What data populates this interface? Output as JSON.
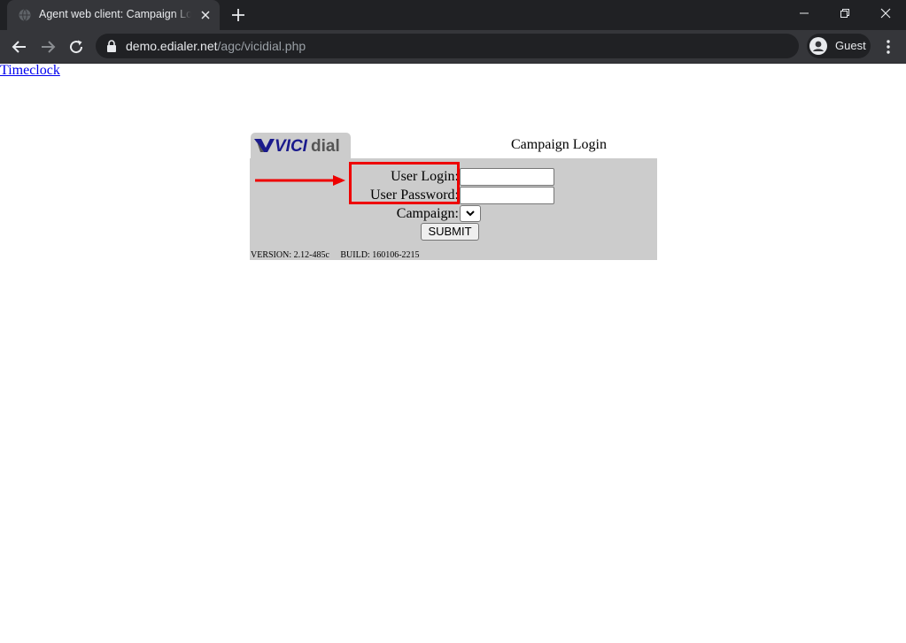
{
  "browser": {
    "tab_title": "Agent web client: Campaign Login",
    "url_host": "demo.edialer.net",
    "url_path": "/agc/vicidial.php",
    "profile_name": "Guest",
    "icons": [
      "globe-icon",
      "close-icon",
      "plus-icon",
      "minimize-icon",
      "restore-icon",
      "window-close-icon",
      "back-arrow-icon",
      "forward-arrow-icon",
      "reload-icon",
      "lock-icon",
      "profile-avatar-icon",
      "kebab-menu-icon"
    ]
  },
  "page": {
    "timeclock_link": "Timeclock",
    "logo": {
      "part1": "VICI",
      "part2": "dial"
    },
    "campaign_title": "Campaign Login",
    "form": {
      "user_login_label": "User Login:",
      "user_login_value": "",
      "user_password_label": "User Password:",
      "user_password_value": "",
      "campaign_label": "Campaign:",
      "campaign_selected": "",
      "submit_label": "SUBMIT"
    },
    "version_text": "VERSION: 2.12-485c     BUILD: 160106-2215"
  },
  "colors": {
    "panel_bg": "#cccccc",
    "link": "#0000ee",
    "annotation": "#ee0000",
    "logo_blue": "#1a1a8c",
    "logo_gray": "#555555"
  }
}
